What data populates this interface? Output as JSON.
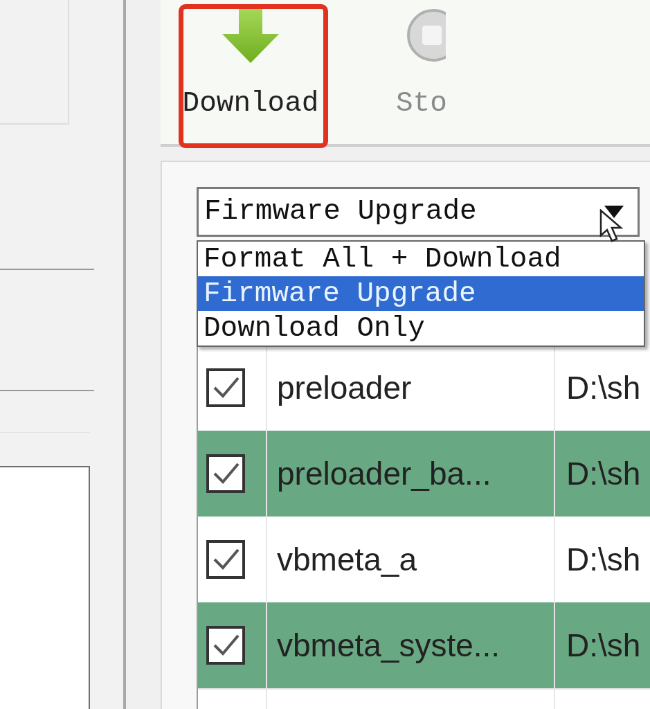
{
  "toolbar": {
    "buttons": [
      {
        "label": "Download",
        "kind": "download",
        "highlighted": true
      },
      {
        "label": "Sto",
        "kind": "stop",
        "highlighted": false
      }
    ]
  },
  "mode_select": {
    "value": "Firmware Upgrade",
    "expanded": true,
    "options": [
      {
        "label": "Format All + Download",
        "selected": false
      },
      {
        "label": "Firmware Upgrade",
        "selected": true
      },
      {
        "label": "Download Only",
        "selected": false
      }
    ]
  },
  "table": {
    "rows": [
      {
        "name": "preloader",
        "location": "D:\\sh",
        "checked": true,
        "shaded": false
      },
      {
        "name": "preloader_ba...",
        "location": "D:\\sh",
        "checked": true,
        "shaded": true
      },
      {
        "name": "vbmeta_a",
        "location": "D:\\sh",
        "checked": true,
        "shaded": false
      },
      {
        "name": "vbmeta_syste...",
        "location": "D:\\sh",
        "checked": true,
        "shaded": true
      }
    ]
  }
}
